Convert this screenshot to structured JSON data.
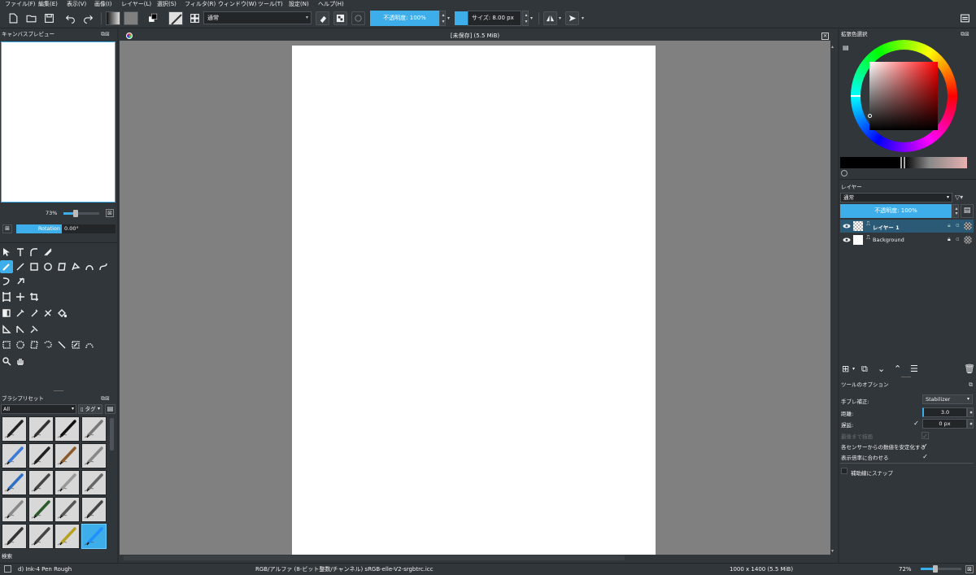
{
  "menu": [
    "ファイル(F)",
    "編集(E)",
    "表示(V)",
    "画像(I)",
    "レイヤー(L)",
    "選択(S)",
    "フィルタ(R)",
    "ウィンドウ(W)",
    "ツール(T)",
    "設定(N)",
    "ヘルプ(H)"
  ],
  "toolbar": {
    "blend_mode": "通常",
    "opacity_label": "不透明度: 100%",
    "size_label": "サイズ: 8.00 px",
    "opacity_value": 1.0
  },
  "canvas_preview": {
    "title": "キャンバスプレビュー",
    "zoom": "73%",
    "rotation_label": "Rotation",
    "rotation_value": "0.00°"
  },
  "document": {
    "title": "[未保存] (5.5 MiB)"
  },
  "brush_presets": {
    "title": "ブラシプリセット",
    "filter": "All",
    "tag_label": "タグ",
    "search_label": "検索",
    "selected_index": 19
  },
  "color_selector": {
    "title": "拡張色選択",
    "accent": "#3daee9"
  },
  "layers": {
    "title": "レイヤー",
    "blend_mode": "通常",
    "opacity_label": "不透明度: 100%",
    "items": [
      {
        "name": "レイヤー 1",
        "selected": true,
        "thumb": "checker"
      },
      {
        "name": "Background",
        "selected": false,
        "thumb": "white",
        "locked": true
      }
    ]
  },
  "tool_options": {
    "title": "ツールのオプション",
    "smoothing_label": "手ブレ補正:",
    "smoothing_value": "Stabilizer",
    "distance_label": "距離:",
    "distance_value": "3.0",
    "delay_label": "遅延:",
    "delay_value": "0 px",
    "finish_label": "最後まで描画",
    "sensor_label": "各センサーからの数値を安定化する",
    "scale_label": "表示倍率に合わせる",
    "snap_label": "補助線にスナップ"
  },
  "status": {
    "brush_name": "d) Ink-4 Pen Rough",
    "color_info": "RGB/アルファ (8-ビット整数/チャンネル)  sRGB-elle-V2-srgbtrc.icc",
    "image_size": "1000 x 1400 (5.5 MiB)",
    "zoom": "72%"
  }
}
